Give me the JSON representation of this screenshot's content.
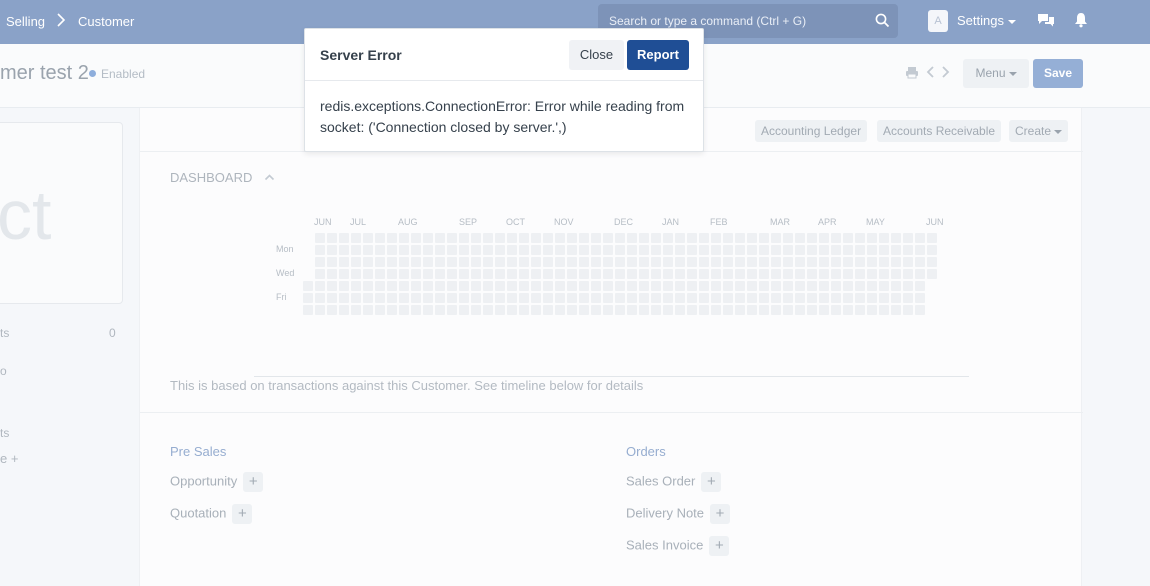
{
  "breadcrumbs": [
    "Selling",
    "Customer"
  ],
  "navbar": {
    "search_placeholder": "Search or type a command (Ctrl + G)",
    "avatar_letter": "A",
    "settings_label": "Settings"
  },
  "header": {
    "title": "mer test 2",
    "status": "Enabled",
    "menu_label": "Menu",
    "save_label": "Save"
  },
  "sidebar": {
    "image_placeholder": "ct",
    "items": [
      {
        "label": "ts",
        "count": "0"
      },
      {
        "label": "o"
      },
      {
        "label": "ts"
      },
      {
        "label": "e +"
      }
    ]
  },
  "toolbar": {
    "accounting_ledger": "Accounting Ledger",
    "accounts_receivable": "Accounts Receivable",
    "create": "Create"
  },
  "dashboard": {
    "title": "DASHBOARD",
    "months": [
      "JUN",
      "JUL",
      "AUG",
      "SEP",
      "OCT",
      "NOV",
      "DEC",
      "JAN",
      "FEB",
      "MAR",
      "APR",
      "MAY",
      "JUN"
    ],
    "days": [
      "Mon",
      "Wed",
      "Fri"
    ],
    "note": "This is based on transactions against this Customer. See timeline below for details"
  },
  "links": {
    "pre_sales": {
      "title": "Pre Sales",
      "items": [
        "Opportunity",
        "Quotation"
      ]
    },
    "orders": {
      "title": "Orders",
      "items": [
        "Sales Order",
        "Delivery Note",
        "Sales Invoice"
      ]
    }
  },
  "modal": {
    "title": "Server Error",
    "close_label": "Close",
    "report_label": "Report",
    "message": "redis.exceptions.ConnectionError: Error while reading from socket: ('Connection closed by server.',)"
  },
  "colors": {
    "navbar": "#8aa2c8",
    "primary": "#1f4e95",
    "save_button": "#95afd6",
    "status_dot": "#8eaedc"
  }
}
